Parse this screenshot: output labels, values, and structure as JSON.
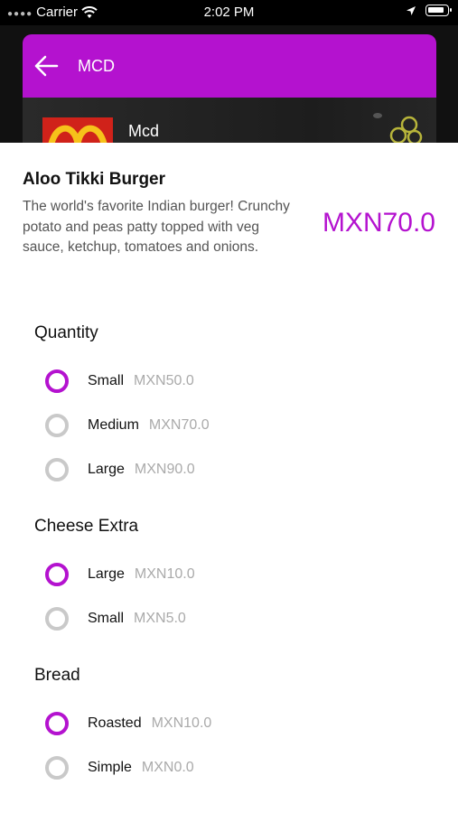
{
  "status_bar": {
    "carrier": "Carrier",
    "time": "2:02 PM"
  },
  "app_bar": {
    "title": "MCD"
  },
  "restaurant": {
    "name": "Mcd"
  },
  "item": {
    "name": "Aloo Tikki Burger",
    "description": "The world's favorite Indian burger! Crunchy potato and peas patty topped with veg sauce, ketchup, tomatoes and onions.",
    "price": "MXN70.0"
  },
  "groups": [
    {
      "title": "Quantity",
      "options": [
        {
          "label": "Small",
          "price": "MXN50.0",
          "selected": true
        },
        {
          "label": "Medium",
          "price": "MXN70.0",
          "selected": false
        },
        {
          "label": "Large",
          "price": "MXN90.0",
          "selected": false
        }
      ]
    },
    {
      "title": "Cheese Extra",
      "options": [
        {
          "label": "Large",
          "price": "MXN10.0",
          "selected": true
        },
        {
          "label": "Small",
          "price": "MXN5.0",
          "selected": false
        }
      ]
    },
    {
      "title": "Bread",
      "options": [
        {
          "label": "Roasted",
          "price": "MXN10.0",
          "selected": true
        },
        {
          "label": "Simple",
          "price": "MXN0.0",
          "selected": false
        }
      ]
    }
  ],
  "colors": {
    "accent": "#b412cf",
    "radio_unselected": "#c9c9c9",
    "price_muted": "#aaaaaa"
  }
}
